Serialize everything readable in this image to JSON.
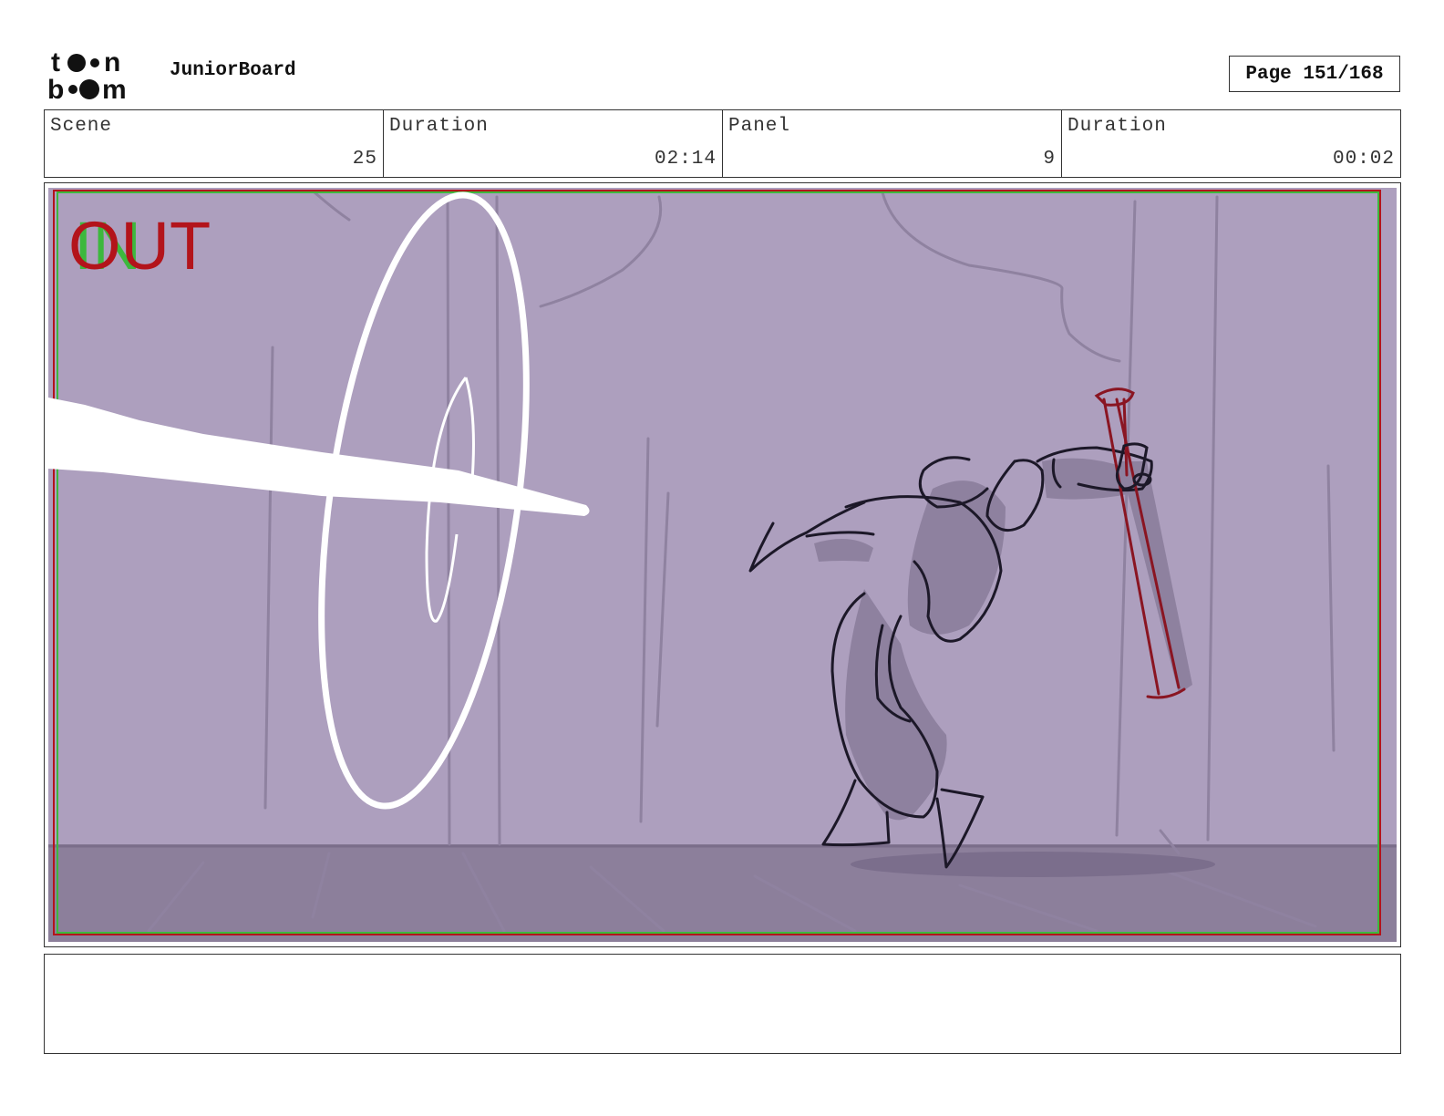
{
  "header": {
    "logo_line1": "toon",
    "logo_line2": "boom",
    "app_name": "JuniorBoard",
    "page_label": "Page 151/168"
  },
  "info": [
    {
      "label": "Scene",
      "value": "25"
    },
    {
      "label": "Duration",
      "value": "02:14"
    },
    {
      "label": "Panel",
      "value": "9"
    },
    {
      "label": "Duration",
      "value": "00:02"
    }
  ],
  "panel": {
    "in_marker": "IN",
    "out_marker": "OUT",
    "background_color": "#ad9fbe",
    "floor_color": "#8c7f9b",
    "safe_frame_red": "#b3141b",
    "safe_frame_green": "#3db83d"
  },
  "notes": {
    "text": ""
  }
}
